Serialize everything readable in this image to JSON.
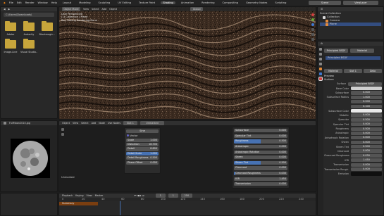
{
  "menu": {
    "items": [
      "File",
      "Edit",
      "Render",
      "Window",
      "Help"
    ],
    "workspaces": [
      "Layout",
      "Modeling",
      "Sculpting",
      "UV Editing",
      "Texture Paint",
      "Shading",
      "Animation",
      "Rendering",
      "Compositing",
      "Geometry Nodes",
      "Scripting"
    ],
    "active_workspace": "Shading",
    "scene_label": "Scene",
    "view_layer_label": "ViewLayer"
  },
  "file_browser": {
    "path": "C:\\Users\\Downloads\\",
    "items": [
      "Adobe",
      "Audacity",
      "Blackmagic...",
      "Image-Line",
      "Visual Studio..."
    ]
  },
  "viewport": {
    "mode": "Object Mode",
    "view_label": "View",
    "select_label": "Select",
    "add_label": "Add",
    "object_label": "Object",
    "shading_label": "Global",
    "overlay_text": [
      "User Perspective",
      "(1) Collection | Plane",
      "Ray Tracing Rendering Done"
    ]
  },
  "image_editor": {
    "image_name": "FullMoon2010.jpg"
  },
  "node_editor": {
    "header_items": [
      "Object",
      "View",
      "Select",
      "Add",
      "Node",
      "Use Nodes"
    ],
    "slot": "Slot 1",
    "material": "Unmarked",
    "material_label": "Unmarked",
    "popup": {
      "title": "Sine",
      "section": "Vector",
      "rows": [
        {
          "label": "Scale",
          "value": "1.000"
        },
        {
          "label": "Distortion",
          "value": "18.700"
        },
        {
          "label": "Detail",
          "value": "8.800"
        },
        {
          "label": "Detail Scale",
          "value": "1.000"
        },
        {
          "label": "Detail Roughness",
          "value": "0.500"
        },
        {
          "label": "Phase Offset",
          "value": "0.000"
        }
      ]
    },
    "bsdf_rows": [
      {
        "label": "Subsurface",
        "value": "0.000",
        "fill": 0.0
      },
      {
        "label": "Specular Tint",
        "value": "0.000",
        "fill": 0.0
      },
      {
        "label": "Roughness",
        "value": "0.500",
        "fill": 0.5
      },
      {
        "label": "Anisotropic",
        "value": "0.000",
        "fill": 0.0
      },
      {
        "label": "Anisotropic Rotation",
        "value": "0.000",
        "fill": 0.0
      },
      {
        "label": "Sheen",
        "value": "0.000",
        "fill": 0.0
      },
      {
        "label": "Sheen Tint",
        "value": "0.500",
        "fill": 0.5
      },
      {
        "label": "Clearcoat",
        "value": "0.000",
        "fill": 0.0
      },
      {
        "label": "Clearcoat Roughness",
        "value": "0.030",
        "fill": 0.03
      },
      {
        "label": "IOR",
        "value": "1.450",
        "fill": 0.0
      },
      {
        "label": "Transmission",
        "value": "0.000",
        "fill": 0.0
      }
    ]
  },
  "timeline": {
    "header_items": [
      "Playback",
      "Keying",
      "View",
      "Marker"
    ],
    "track_name": "Summary",
    "frame_start": "1",
    "frame_end": "250",
    "current_frame": "1",
    "ruler": [
      "0",
      "20",
      "40",
      "60",
      "80",
      "100",
      "120",
      "140",
      "160",
      "180",
      "200",
      "220",
      "240"
    ]
  },
  "outliner": {
    "title": "Scene Collection",
    "items": [
      "Collection",
      "Camera",
      "Plane"
    ]
  },
  "properties": {
    "material_name": "Principled BSDF",
    "surface_label": "Surface",
    "preview_label": "Preview",
    "surface_value": "Principled BSDF",
    "rows": [
      {
        "label": "Base Color",
        "value": ""
      },
      {
        "label": "Subsurface",
        "value": "0.000"
      },
      {
        "label": "Subsurface Radius",
        "value": "1.000"
      },
      {
        "label": "",
        "value": "0.200"
      },
      {
        "label": "",
        "value": "0.100"
      },
      {
        "label": "Subsurface Color",
        "value": ""
      },
      {
        "label": "Metallic",
        "value": "0.000"
      },
      {
        "label": "Specular",
        "value": "0.500"
      },
      {
        "label": "Specular Tint",
        "value": "0.000"
      },
      {
        "label": "Roughness",
        "value": "0.500"
      },
      {
        "label": "Anisotropic",
        "value": "0.000"
      },
      {
        "label": "Anisotropic Rotation",
        "value": "0.000"
      },
      {
        "label": "Sheen",
        "value": "0.000"
      },
      {
        "label": "Sheen Tint",
        "value": "0.500"
      },
      {
        "label": "Clearcoat",
        "value": "0.000"
      },
      {
        "label": "Clearcoat Roughness",
        "value": "0.030"
      },
      {
        "label": "IOR",
        "value": "1.450"
      },
      {
        "label": "Transmission",
        "value": "0.000"
      },
      {
        "label": "Transmission Rough.",
        "value": "0.000"
      },
      {
        "label": "Emission",
        "value": ""
      }
    ],
    "tabs": [
      "Material",
      "Slot 1",
      "Data"
    ]
  },
  "colors": {
    "accent": "#4772b3",
    "active_tab": "#4a4a4a",
    "folder": "#c7a53b"
  }
}
